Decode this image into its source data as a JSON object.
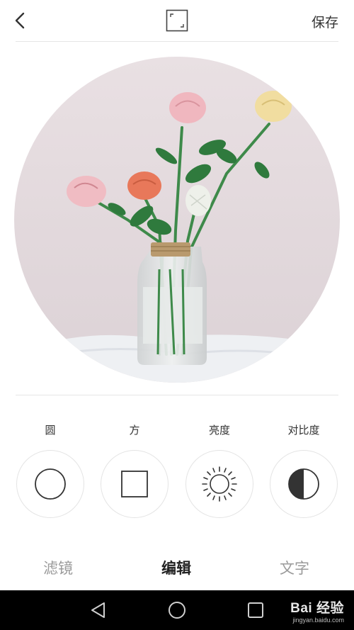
{
  "header": {
    "save_label": "保存"
  },
  "tools": [
    {
      "label": "圆",
      "icon": "circle-icon"
    },
    {
      "label": "方",
      "icon": "square-icon"
    },
    {
      "label": "亮度",
      "icon": "brightness-icon"
    },
    {
      "label": "对比度",
      "icon": "contrast-icon"
    }
  ],
  "tabs": [
    {
      "label": "滤镜",
      "active": false
    },
    {
      "label": "编辑",
      "active": true
    },
    {
      "label": "文字",
      "active": false
    }
  ],
  "watermark": {
    "main": "Bai 经验",
    "sub": "jingyan.baidu.com"
  },
  "colors": {
    "background": "#ffffff",
    "navbar": "#000000",
    "inactive_tab": "#9a9a9a",
    "active_tab": "#222222"
  }
}
